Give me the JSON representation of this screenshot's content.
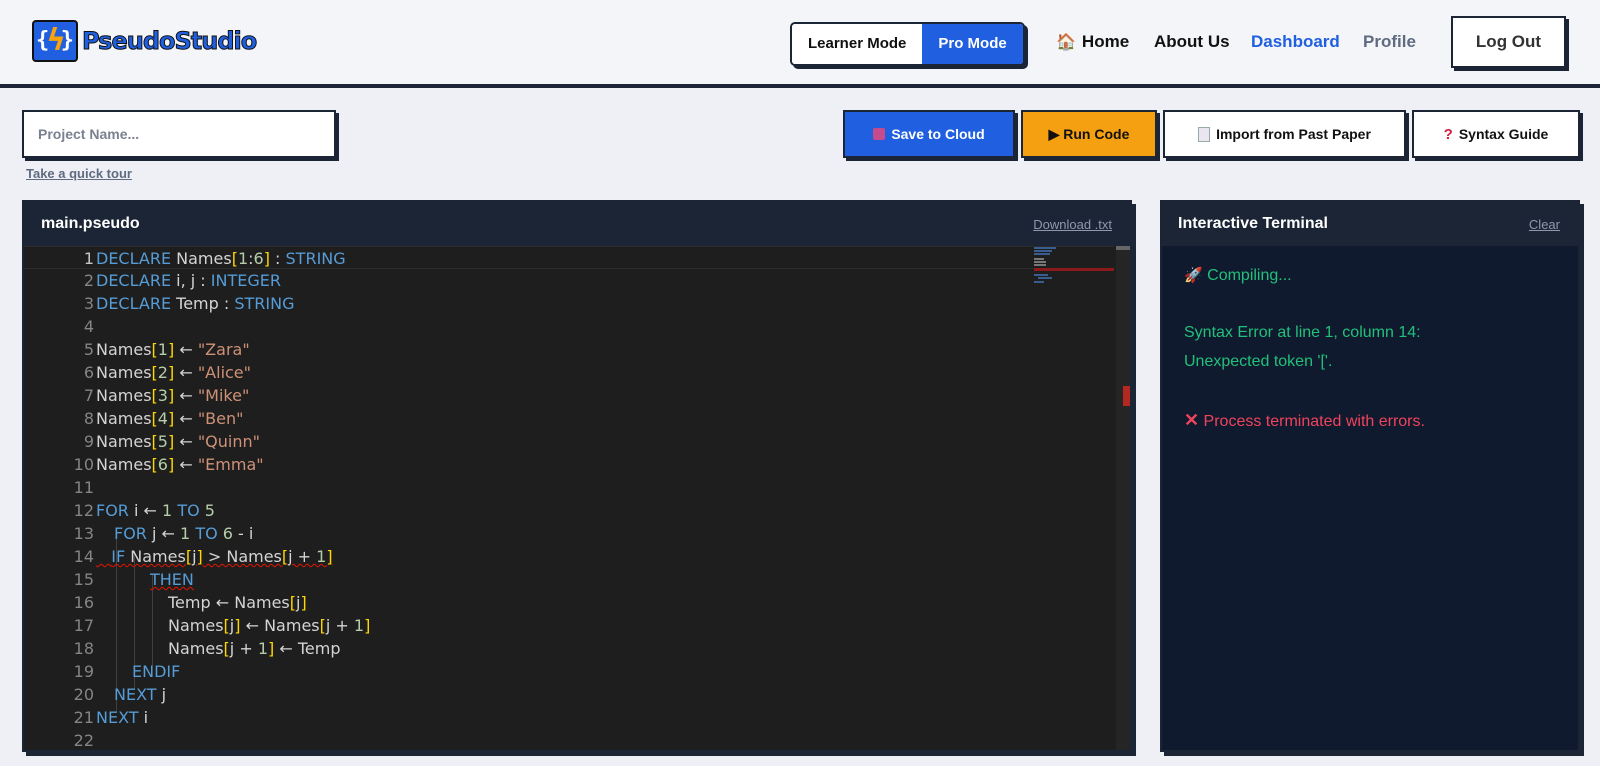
{
  "header": {
    "logo_text": "PseudoStudio",
    "modes": {
      "learner": "Learner Mode",
      "pro": "Pro Mode",
      "active": "pro"
    },
    "nav": {
      "home": "Home",
      "about": "About Us",
      "dashboard": "Dashboard",
      "profile": "Profile"
    },
    "logout": "Log Out",
    "icons": {
      "home": "house-icon",
      "logo": "bolt-braces-icon"
    }
  },
  "toolbar": {
    "project_placeholder": "Project Name...",
    "tour_link": "Take a quick tour",
    "save": "Save to Cloud",
    "run": "▶ Run Code",
    "import": "Import from Past Paper",
    "syntax": "Syntax Guide"
  },
  "editor": {
    "filename": "main.pseudo",
    "download": "Download .txt",
    "active_line": 1,
    "line_numbers": [
      "1",
      "2",
      "3",
      "4",
      "5",
      "6",
      "7",
      "8",
      "9",
      "10",
      "11",
      "12",
      "13",
      "14",
      "15",
      "16",
      "17",
      "18",
      "19",
      "20",
      "21",
      "22"
    ]
  },
  "terminal": {
    "title": "Interactive Terminal",
    "clear": "Clear",
    "compiling": "Compiling...",
    "error_line1": "Syntax Error at line 1, column 14:",
    "error_line2": "Unexpected token '['.",
    "terminated": "Process terminated with errors."
  },
  "colors": {
    "accent_blue": "#1f5fe0",
    "run_orange": "#f4a010",
    "terminal_green": "#22c07a",
    "terminal_red": "#f0435c",
    "dark_navy": "#1c2536"
  }
}
